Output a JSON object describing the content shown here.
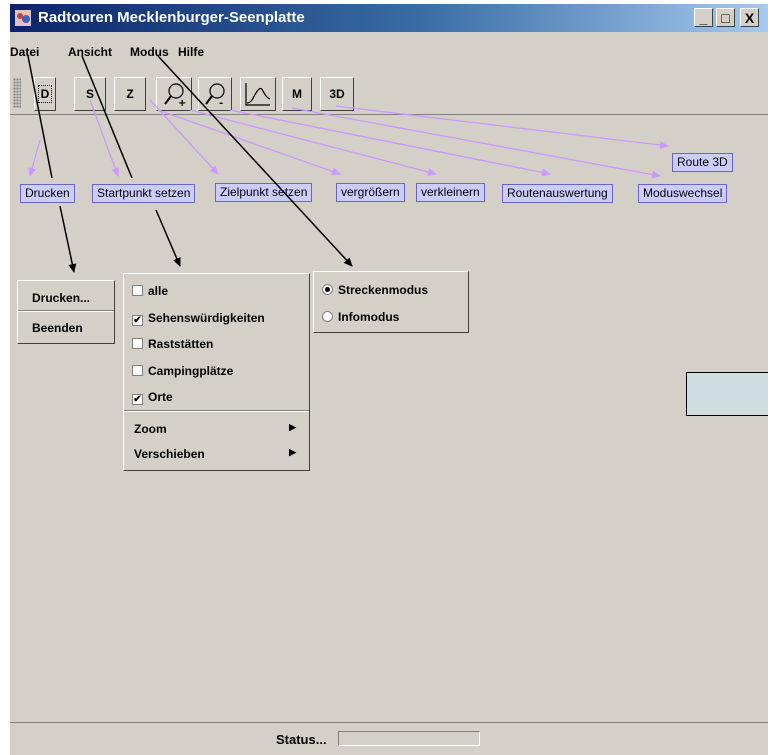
{
  "window": {
    "title": "Radtouren Mecklenburger-Seenplatte",
    "controls": [
      "_",
      "□",
      "X"
    ]
  },
  "menubar": [
    "Datei",
    "Ansicht",
    "Modus",
    "Hilfe"
  ],
  "toolbar": {
    "buttons": [
      "D",
      "S",
      "Z",
      "zoom-in-icon",
      "zoom-out-icon",
      "route-graph-icon",
      "M",
      "3D"
    ]
  },
  "callouts": {
    "drucken": "Drucken",
    "startpunkt": "Startpunkt setzen",
    "zielpunkt": "Zielpunkt setzen",
    "vergroessern": "vergrößern",
    "verkleinern": "verkleinern",
    "routenauswertung": "Routenauswertung",
    "moduswechsel": "Moduswechsel",
    "route3d": "Route 3D"
  },
  "datei_menu": {
    "items": [
      "Drucken...",
      "Beenden"
    ]
  },
  "ansicht_menu": {
    "items": [
      {
        "label": "alle",
        "checked": false
      },
      {
        "label": "Sehenswürdigkeiten",
        "checked": true
      },
      {
        "label": "Raststätten",
        "checked": false
      },
      {
        "label": "Campingplätze",
        "checked": false
      },
      {
        "label": "Orte",
        "checked": true
      }
    ],
    "submenus": [
      "Zoom",
      "Verschieben"
    ]
  },
  "modus_menu": {
    "items": [
      {
        "label": "Streckenmodus",
        "selected": true
      },
      {
        "label": "Infomodus",
        "selected": false
      }
    ]
  },
  "status": {
    "label": "Status..."
  },
  "colors": {
    "callout_bg": "#ccccff",
    "callout_border": "#6666cc",
    "arrow_purple": "#cc99ff",
    "window_bg": "#d4d0c8"
  }
}
